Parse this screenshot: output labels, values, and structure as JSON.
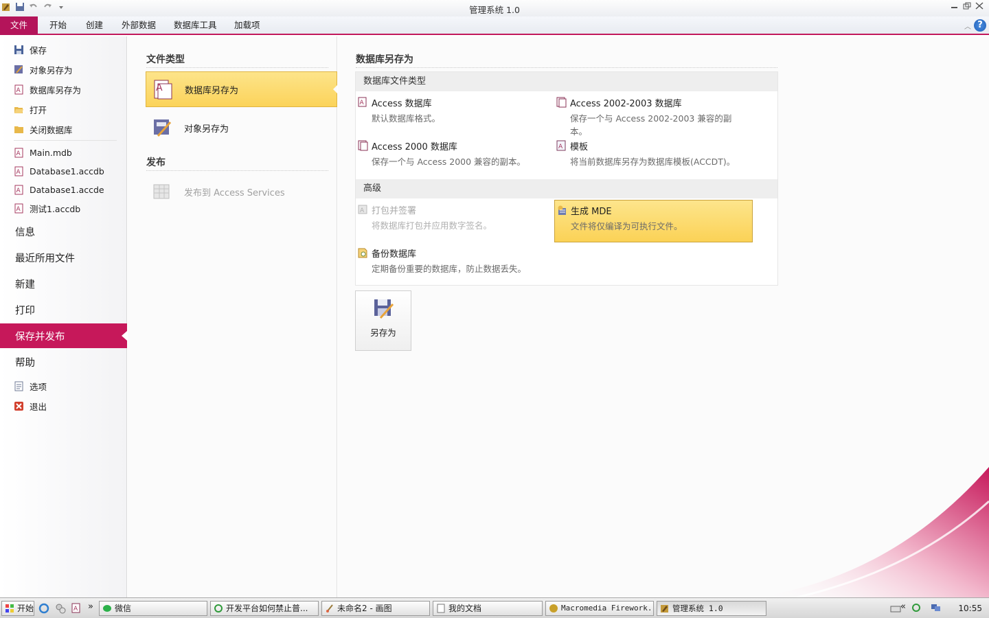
{
  "window": {
    "title": "管理系统 1.0"
  },
  "ribbon": {
    "tabs": [
      "文件",
      "开始",
      "创建",
      "外部数据",
      "数据库工具",
      "加载项"
    ]
  },
  "leftnav": {
    "commands": [
      {
        "label": "保存",
        "icon": "save-icon"
      },
      {
        "label": "对象另存为",
        "icon": "object-save-as-icon"
      },
      {
        "label": "数据库另存为",
        "icon": "database-save-as-icon"
      },
      {
        "label": "打开",
        "icon": "open-folder-icon"
      },
      {
        "label": "关闭数据库",
        "icon": "close-folder-icon"
      }
    ],
    "recent": [
      "Main.mdb",
      "Database1.accdb",
      "Database1.accde",
      "测试1.accdb"
    ],
    "sections": [
      "信息",
      "最近所用文件",
      "新建",
      "打印",
      "保存并发布",
      "帮助"
    ],
    "bottom": [
      {
        "label": "选项",
        "icon": "options-icon"
      },
      {
        "label": "退出",
        "icon": "exit-icon"
      }
    ]
  },
  "filetypes": {
    "heading": "文件类型",
    "save_db": "数据库另存为",
    "save_obj": "对象另存为",
    "publish_heading": "发布",
    "publish": "发布到 Access Services"
  },
  "main": {
    "heading": "数据库另存为",
    "band1": "数据库文件类型",
    "opts1": [
      {
        "title": "Access 数据库",
        "desc": "默认数据库格式。"
      },
      {
        "title": "Access 2002-2003 数据库",
        "desc": "保存一个与 Access 2002-2003 兼容的副本。"
      },
      {
        "title": "Access 2000 数据库",
        "desc": "保存一个与 Access 2000 兼容的副本。"
      },
      {
        "title": "模板",
        "desc": "将当前数据库另存为数据库模板(ACCDT)。"
      }
    ],
    "band2": "高级",
    "opts2": [
      {
        "title": "打包并签署",
        "desc": "将数据库打包并应用数字签名。"
      },
      {
        "title": "生成 MDE",
        "desc": "文件将仅编译为可执行文件。"
      },
      {
        "title": "备份数据库",
        "desc": "定期备份重要的数据库，防止数据丢失。"
      }
    ],
    "saveas_button": "另存为"
  },
  "taskbar": {
    "start": "开始",
    "items": [
      "微信",
      "开发平台如何禁止普...",
      "未命名2 - 画图",
      "我的文档",
      "Macromedia Firework...",
      "管理系统 1.0"
    ],
    "chevron": "»",
    "tray_chevron": "«",
    "clock": "10:55"
  },
  "colors": {
    "accent": "#c6185a",
    "highlight": "#fbd35a"
  }
}
